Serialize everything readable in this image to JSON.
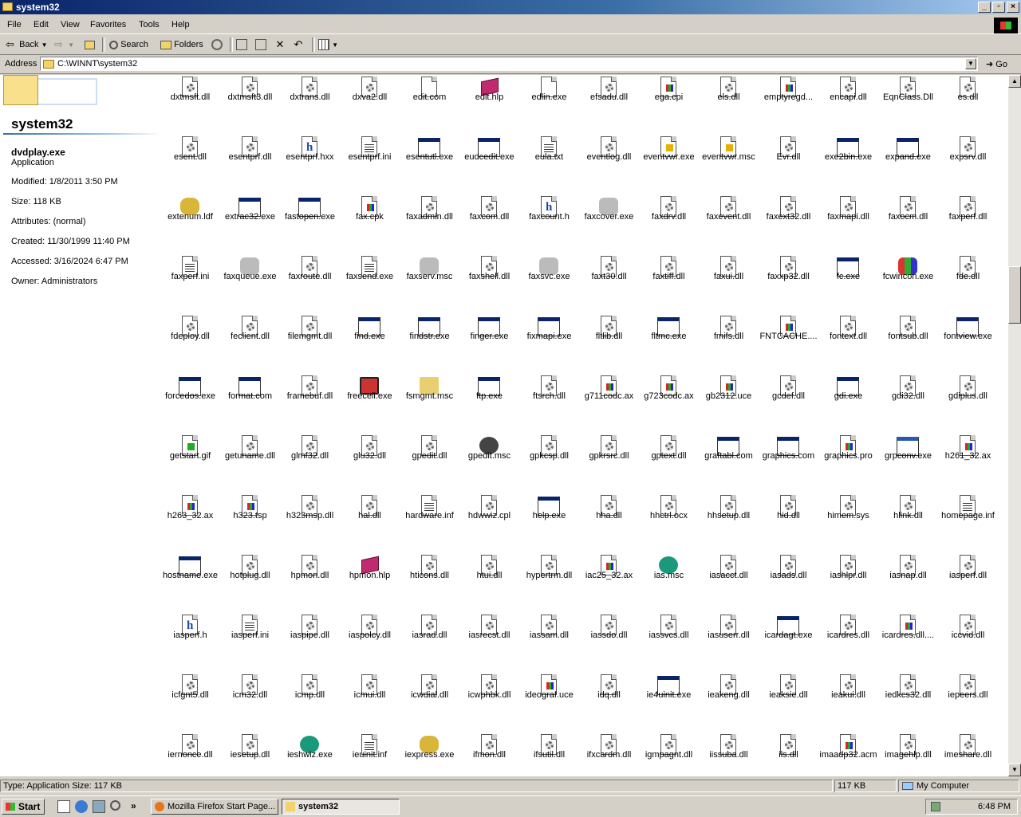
{
  "window": {
    "title": "system32"
  },
  "menu": [
    "File",
    "Edit",
    "View",
    "Favorites",
    "Tools",
    "Help"
  ],
  "toolbar": {
    "back": "Back",
    "search": "Search",
    "folders": "Folders"
  },
  "address": {
    "label": "Address",
    "value": "C:\\WINNT\\system32",
    "go": "Go"
  },
  "details": {
    "folder_name": "system32",
    "selected_name": "dvdplay.exe",
    "selected_type": "Application",
    "modified": "Modified: 1/8/2011 3:50 PM",
    "size": "Size: 118 KB",
    "attributes": "Attributes: (normal)",
    "created": "Created: 11/30/1999 11:40 PM",
    "accessed": "Accessed: 3/16/2024 6:47 PM",
    "owner": "Owner: Administrators"
  },
  "files": [
    {
      "name": "dxtmsft.dll",
      "icon": "dll"
    },
    {
      "name": "dxtmsft3.dll",
      "icon": "dll"
    },
    {
      "name": "dxtrans.dll",
      "icon": "dll"
    },
    {
      "name": "dxva2.dll",
      "icon": "dll"
    },
    {
      "name": "edit.com",
      "icon": "doc"
    },
    {
      "name": "edit.hlp",
      "icon": "hlp"
    },
    {
      "name": "edlin.exe",
      "icon": "doc"
    },
    {
      "name": "efsadu.dll",
      "icon": "dll"
    },
    {
      "name": "ega.cpi",
      "icon": "media"
    },
    {
      "name": "els.dll",
      "icon": "dll"
    },
    {
      "name": "emptyregd...",
      "icon": "media"
    },
    {
      "name": "encapi.dll",
      "icon": "dll"
    },
    {
      "name": "EqnClass.Dll",
      "icon": "dll"
    },
    {
      "name": "es.dll",
      "icon": "dll"
    },
    {
      "name": "esent.dll",
      "icon": "dll"
    },
    {
      "name": "esentprf.dll",
      "icon": "dll"
    },
    {
      "name": "esentprf.hxx",
      "icon": "h"
    },
    {
      "name": "esentprf.ini",
      "icon": "ini"
    },
    {
      "name": "esentutl.exe",
      "icon": "exe"
    },
    {
      "name": "eudcedit.exe",
      "icon": "exe"
    },
    {
      "name": "eula.txt",
      "icon": "txt"
    },
    {
      "name": "eventlog.dll",
      "icon": "dll"
    },
    {
      "name": "eventvwr.exe",
      "icon": "msc"
    },
    {
      "name": "eventvwr.msc",
      "icon": "msc"
    },
    {
      "name": "Evr.dll",
      "icon": "dll"
    },
    {
      "name": "exe2bin.exe",
      "icon": "exe"
    },
    {
      "name": "expand.exe",
      "icon": "exe"
    },
    {
      "name": "expsrv.dll",
      "icon": "dll"
    },
    {
      "name": "extenum.ldf",
      "icon": "db"
    },
    {
      "name": "extrac32.exe",
      "icon": "exe"
    },
    {
      "name": "fastopen.exe",
      "icon": "exe"
    },
    {
      "name": "fax.cpk",
      "icon": "media"
    },
    {
      "name": "faxadmin.dll",
      "icon": "dll"
    },
    {
      "name": "faxcom.dll",
      "icon": "dll"
    },
    {
      "name": "faxcount.h",
      "icon": "h"
    },
    {
      "name": "faxcover.exe",
      "icon": "fax"
    },
    {
      "name": "faxdrv.dll",
      "icon": "dll"
    },
    {
      "name": "faxevent.dll",
      "icon": "dll"
    },
    {
      "name": "faxext32.dll",
      "icon": "dll"
    },
    {
      "name": "faxmapi.dll",
      "icon": "dll"
    },
    {
      "name": "faxocm.dll",
      "icon": "dll"
    },
    {
      "name": "faxperf.dll",
      "icon": "dll"
    },
    {
      "name": "faxperf.ini",
      "icon": "ini"
    },
    {
      "name": "faxqueue.exe",
      "icon": "fax"
    },
    {
      "name": "faxroute.dll",
      "icon": "dll"
    },
    {
      "name": "faxsend.exe",
      "icon": "txt"
    },
    {
      "name": "faxserv.msc",
      "icon": "fax"
    },
    {
      "name": "faxshell.dll",
      "icon": "dll"
    },
    {
      "name": "faxsvc.exe",
      "icon": "fax"
    },
    {
      "name": "faxt30.dll",
      "icon": "dll"
    },
    {
      "name": "faxtiff.dll",
      "icon": "dll"
    },
    {
      "name": "faxui.dll",
      "icon": "dll"
    },
    {
      "name": "faxxp32.dll",
      "icon": "dll"
    },
    {
      "name": "fc.exe",
      "icon": "exe"
    },
    {
      "name": "fcwincon.exe",
      "icon": "blocks"
    },
    {
      "name": "fde.dll",
      "icon": "dll"
    },
    {
      "name": "fdeploy.dll",
      "icon": "dll"
    },
    {
      "name": "feclient.dll",
      "icon": "dll"
    },
    {
      "name": "filemgmt.dll",
      "icon": "dll"
    },
    {
      "name": "find.exe",
      "icon": "exe"
    },
    {
      "name": "findstr.exe",
      "icon": "exe"
    },
    {
      "name": "finger.exe",
      "icon": "exe"
    },
    {
      "name": "fixmapi.exe",
      "icon": "exe"
    },
    {
      "name": "fltlib.dll",
      "icon": "dll"
    },
    {
      "name": "fltmc.exe",
      "icon": "exe"
    },
    {
      "name": "fmifs.dll",
      "icon": "dll"
    },
    {
      "name": "FNTCACHE....",
      "icon": "media"
    },
    {
      "name": "fontext.dll",
      "icon": "dll"
    },
    {
      "name": "fontsub.dll",
      "icon": "dll"
    },
    {
      "name": "fontview.exe",
      "icon": "exe"
    },
    {
      "name": "forcedos.exe",
      "icon": "exe"
    },
    {
      "name": "format.com",
      "icon": "exe"
    },
    {
      "name": "framebuf.dll",
      "icon": "dll"
    },
    {
      "name": "freecell.exe",
      "icon": "cards"
    },
    {
      "name": "fsmgmt.msc",
      "icon": "folder"
    },
    {
      "name": "ftp.exe",
      "icon": "exe"
    },
    {
      "name": "ftsrch.dll",
      "icon": "dll"
    },
    {
      "name": "g711codc.ax",
      "icon": "media"
    },
    {
      "name": "g723codc.ax",
      "icon": "media"
    },
    {
      "name": "gb2312.uce",
      "icon": "media"
    },
    {
      "name": "gcdef.dll",
      "icon": "dll"
    },
    {
      "name": "gdi.exe",
      "icon": "exe"
    },
    {
      "name": "gdi32.dll",
      "icon": "dll"
    },
    {
      "name": "gdiplus.dll",
      "icon": "dll"
    },
    {
      "name": "getstart.gif",
      "icon": "gif"
    },
    {
      "name": "getuname.dll",
      "icon": "dll"
    },
    {
      "name": "glmf32.dll",
      "icon": "dll"
    },
    {
      "name": "glu32.dll",
      "icon": "dll"
    },
    {
      "name": "gpedit.dll",
      "icon": "dll"
    },
    {
      "name": "gpedit.msc",
      "icon": "users"
    },
    {
      "name": "gpkcsp.dll",
      "icon": "dll"
    },
    {
      "name": "gpkrsrc.dll",
      "icon": "dll"
    },
    {
      "name": "gptext.dll",
      "icon": "dll"
    },
    {
      "name": "graftabl.com",
      "icon": "exe"
    },
    {
      "name": "graphics.com",
      "icon": "exe"
    },
    {
      "name": "graphics.pro",
      "icon": "media"
    },
    {
      "name": "grpconv.exe",
      "icon": "grp"
    },
    {
      "name": "h261_32.ax",
      "icon": "media"
    },
    {
      "name": "h263_32.ax",
      "icon": "media"
    },
    {
      "name": "h323.tsp",
      "icon": "media"
    },
    {
      "name": "h323msp.dll",
      "icon": "dll"
    },
    {
      "name": "hal.dll",
      "icon": "dll"
    },
    {
      "name": "hardware.inf",
      "icon": "ini"
    },
    {
      "name": "hdwwiz.cpl",
      "icon": "dll"
    },
    {
      "name": "help.exe",
      "icon": "exe"
    },
    {
      "name": "hha.dll",
      "icon": "dll"
    },
    {
      "name": "hhctrl.ocx",
      "icon": "dll"
    },
    {
      "name": "hhsetup.dll",
      "icon": "dll"
    },
    {
      "name": "hid.dll",
      "icon": "dll"
    },
    {
      "name": "himem.sys",
      "icon": "dll"
    },
    {
      "name": "hlink.dll",
      "icon": "dll"
    },
    {
      "name": "homepage.inf",
      "icon": "ini"
    },
    {
      "name": "hostname.exe",
      "icon": "exe"
    },
    {
      "name": "hotplug.dll",
      "icon": "dll"
    },
    {
      "name": "hpmon.dll",
      "icon": "dll"
    },
    {
      "name": "hpmon.hlp",
      "icon": "hlp"
    },
    {
      "name": "hticons.dll",
      "icon": "dll"
    },
    {
      "name": "htui.dll",
      "icon": "dll"
    },
    {
      "name": "hypertrm.dll",
      "icon": "dll"
    },
    {
      "name": "iac25_32.ax",
      "icon": "media"
    },
    {
      "name": "ias.msc",
      "icon": "globe"
    },
    {
      "name": "iasacct.dll",
      "icon": "dll"
    },
    {
      "name": "iasads.dll",
      "icon": "dll"
    },
    {
      "name": "iashlpr.dll",
      "icon": "dll"
    },
    {
      "name": "iasnap.dll",
      "icon": "dll"
    },
    {
      "name": "iasperf.dll",
      "icon": "dll"
    },
    {
      "name": "iasperf.h",
      "icon": "h"
    },
    {
      "name": "iasperf.ini",
      "icon": "ini"
    },
    {
      "name": "iaspipe.dll",
      "icon": "dll"
    },
    {
      "name": "iaspolcy.dll",
      "icon": "dll"
    },
    {
      "name": "iasrad.dll",
      "icon": "dll"
    },
    {
      "name": "iasrecst.dll",
      "icon": "dll"
    },
    {
      "name": "iassam.dll",
      "icon": "dll"
    },
    {
      "name": "iassdo.dll",
      "icon": "dll"
    },
    {
      "name": "iassvcs.dll",
      "icon": "dll"
    },
    {
      "name": "iasuserr.dll",
      "icon": "dll"
    },
    {
      "name": "icardagt.exe",
      "icon": "exe"
    },
    {
      "name": "icardres.dll",
      "icon": "dll"
    },
    {
      "name": "icardres.dll....",
      "icon": "media"
    },
    {
      "name": "iccvid.dll",
      "icon": "dll"
    },
    {
      "name": "icfgnt5.dll",
      "icon": "dll"
    },
    {
      "name": "icm32.dll",
      "icon": "dll"
    },
    {
      "name": "icmp.dll",
      "icon": "dll"
    },
    {
      "name": "icmui.dll",
      "icon": "dll"
    },
    {
      "name": "icwdial.dll",
      "icon": "dll"
    },
    {
      "name": "icwphbk.dll",
      "icon": "dll"
    },
    {
      "name": "ideograf.uce",
      "icon": "media"
    },
    {
      "name": "idq.dll",
      "icon": "dll"
    },
    {
      "name": "ie4uinit.exe",
      "icon": "exe"
    },
    {
      "name": "ieakeng.dll",
      "icon": "dll"
    },
    {
      "name": "ieaksie.dll",
      "icon": "dll"
    },
    {
      "name": "ieakui.dll",
      "icon": "dll"
    },
    {
      "name": "iedkcs32.dll",
      "icon": "dll"
    },
    {
      "name": "iepeers.dll",
      "icon": "dll"
    },
    {
      "name": "iernonce.dll",
      "icon": "dll"
    },
    {
      "name": "iesetup.dll",
      "icon": "dll"
    },
    {
      "name": "ieshwiz.exe",
      "icon": "globe"
    },
    {
      "name": "ieuinit.inf",
      "icon": "ini"
    },
    {
      "name": "iexpress.exe",
      "icon": "db"
    },
    {
      "name": "ifmon.dll",
      "icon": "dll"
    },
    {
      "name": "ifsutil.dll",
      "icon": "dll"
    },
    {
      "name": "ifxcardm.dll",
      "icon": "dll"
    },
    {
      "name": "igmpagnt.dll",
      "icon": "dll"
    },
    {
      "name": "iissuba.dll",
      "icon": "dll"
    },
    {
      "name": "ils.dll",
      "icon": "dll"
    },
    {
      "name": "imaadp32.acm",
      "icon": "media"
    },
    {
      "name": "imagehlp.dll",
      "icon": "dll"
    },
    {
      "name": "imeshare.dll",
      "icon": "dll"
    }
  ],
  "status": {
    "left": "Type: Application Size: 117 KB",
    "size": "117 KB",
    "zone": "My Computer"
  },
  "taskbar": {
    "start": "Start",
    "task1": "Mozilla Firefox Start Page...",
    "task2": "system32",
    "clock": "6:48 PM"
  }
}
